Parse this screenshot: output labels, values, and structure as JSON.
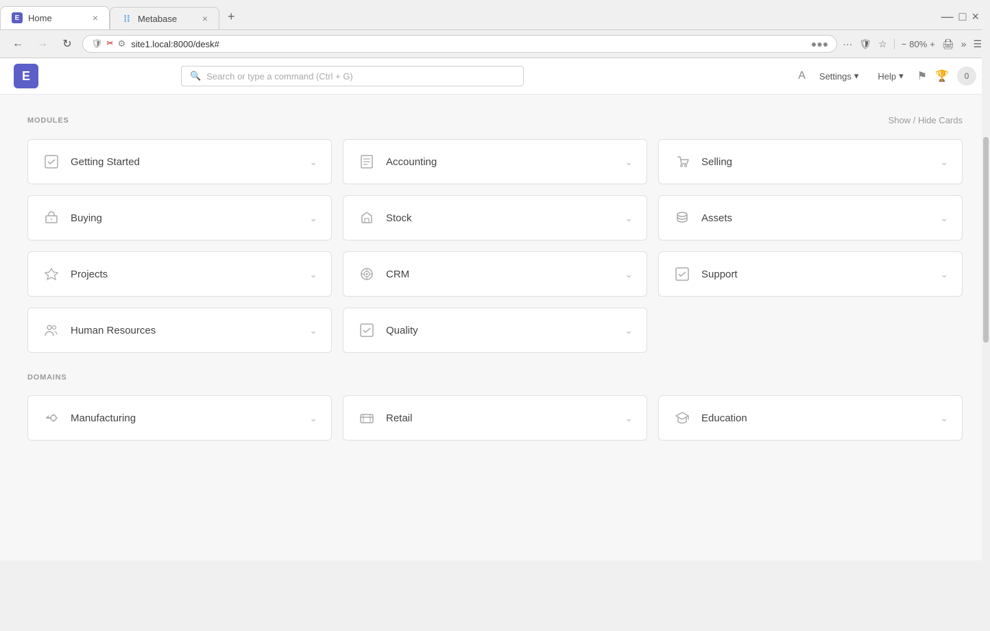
{
  "browser": {
    "tabs": [
      {
        "id": "home",
        "label": "Home",
        "icon": "E",
        "active": true,
        "close": "×"
      },
      {
        "id": "metabase",
        "label": "Metabase",
        "icon": "⁞⁞",
        "active": false,
        "close": "×"
      }
    ],
    "new_tab": "+",
    "window_controls": {
      "minimize": "—",
      "restore": "□",
      "close": "×"
    },
    "address": "site1.local:8000/desk#",
    "zoom": "80%",
    "more_btn": "···"
  },
  "app": {
    "logo": "E",
    "search_placeholder": "Search or type a command (Ctrl + G)",
    "settings_label": "Settings",
    "help_label": "Help",
    "badge_count": "0"
  },
  "modules_section": {
    "label": "MODULES",
    "show_hide": "Show / Hide Cards",
    "cards": [
      {
        "id": "getting-started",
        "label": "Getting Started",
        "icon": "✓☐"
      },
      {
        "id": "accounting",
        "label": "Accounting",
        "icon": "📋"
      },
      {
        "id": "selling",
        "label": "Selling",
        "icon": "🏷"
      },
      {
        "id": "buying",
        "label": "Buying",
        "icon": "💼"
      },
      {
        "id": "stock",
        "label": "Stock",
        "icon": "📦"
      },
      {
        "id": "assets",
        "label": "Assets",
        "icon": "🗄"
      },
      {
        "id": "projects",
        "label": "Projects",
        "icon": "🚀"
      },
      {
        "id": "crm",
        "label": "CRM",
        "icon": "📡"
      },
      {
        "id": "support",
        "label": "Support",
        "icon": "✓☐"
      },
      {
        "id": "human-resources",
        "label": "Human Resources",
        "icon": "👥"
      },
      {
        "id": "quality",
        "label": "Quality",
        "icon": "✓☐"
      }
    ]
  },
  "domains_section": {
    "label": "DOMAINS",
    "cards": [
      {
        "id": "manufacturing",
        "label": "Manufacturing",
        "icon": "🔧"
      },
      {
        "id": "retail",
        "label": "Retail",
        "icon": "💳"
      },
      {
        "id": "education",
        "label": "Education",
        "icon": "🎓"
      }
    ]
  },
  "icons": {
    "chevron_down": "⌄",
    "search": "🔍",
    "settings_arrow": "▾",
    "help_arrow": "▾"
  }
}
